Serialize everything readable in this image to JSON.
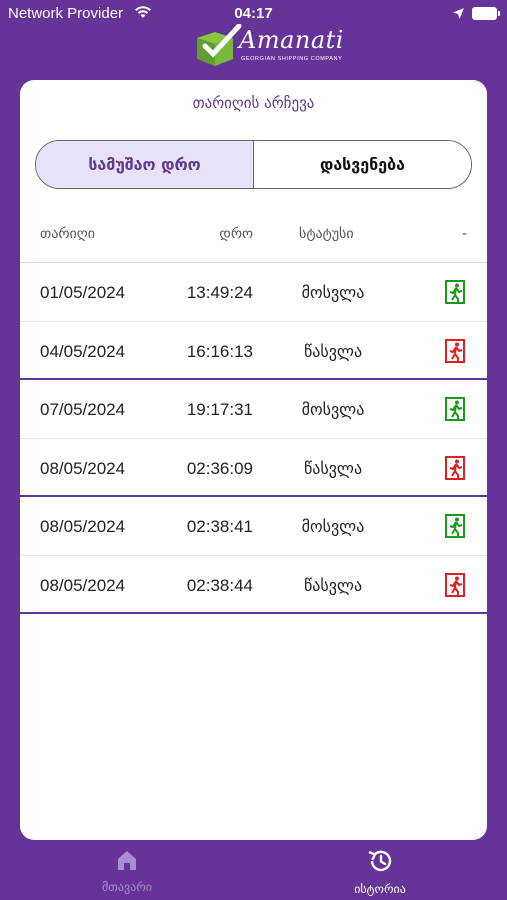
{
  "status_bar": {
    "carrier": "Network Provider",
    "time": "04:17"
  },
  "logo": {
    "name": "Amanati",
    "subtitle": "GEORGIAN SHIPPING COMPANY"
  },
  "page": {
    "title": "თარიღის არჩევა"
  },
  "segments": [
    {
      "label": "სამუშაო დრო",
      "active": true
    },
    {
      "label": "დასვენება",
      "active": false
    }
  ],
  "table": {
    "headers": {
      "date": "თარიღი",
      "time": "დრო",
      "status": "სტატუსი",
      "action": "-"
    },
    "rows": [
      {
        "date": "01/05/2024",
        "time": "13:49:24",
        "status": "მოსვლა",
        "icon": "entry-icon",
        "color": "#1a9a1a"
      },
      {
        "date": "04/05/2024",
        "time": "16:16:13",
        "status": "წასვლა",
        "icon": "exit-icon",
        "color": "#e02020"
      },
      {
        "date": "07/05/2024",
        "time": "19:17:31",
        "status": "მოსვლა",
        "icon": "entry-icon",
        "color": "#1a9a1a"
      },
      {
        "date": "08/05/2024",
        "time": "02:36:09",
        "status": "წასვლა",
        "icon": "exit-icon",
        "color": "#e02020"
      },
      {
        "date": "08/05/2024",
        "time": "02:38:41",
        "status": "მოსვლა",
        "icon": "entry-icon",
        "color": "#1a9a1a"
      },
      {
        "date": "08/05/2024",
        "time": "02:38:44",
        "status": "წასვლა",
        "icon": "exit-icon",
        "color": "#e02020"
      }
    ]
  },
  "tabbar": {
    "home_label": "მთავარი",
    "history_label": "ისტორია",
    "active": "history"
  },
  "colors": {
    "brand": "#663399",
    "accent_text": "#5b3a8f",
    "segment_active_bg": "#e7e2f7",
    "entry": "#1a9a1a",
    "exit": "#e02020"
  }
}
